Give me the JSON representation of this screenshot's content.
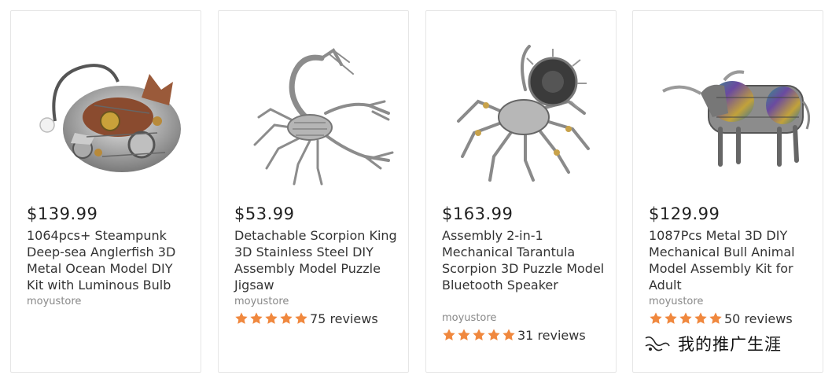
{
  "products": [
    {
      "price": "$139.99",
      "title": "1064pcs+ Steampunk Deep-sea Anglerfish 3D Metal Ocean Model DIY Kit with Luminous Bulb",
      "store": "moyustore",
      "image_subject": "steampunk anglerfish metal model"
    },
    {
      "price": "$53.99",
      "title": "Detachable Scorpion King 3D Stainless Steel DIY Assembly Model Puzzle Jigsaw",
      "store": "moyustore",
      "rating": 5,
      "reviews": "75 reviews",
      "image_subject": "metal scorpion model"
    },
    {
      "price": "$163.99",
      "title": "Assembly 2-in-1 Mechanical Tarantula Scorpion 3D Puzzle Model Bluetooth Speaker",
      "store": "moyustore",
      "rating": 5,
      "reviews": "31 reviews",
      "image_subject": "mechanical tarantula speaker model"
    },
    {
      "price": "$129.99",
      "title": "1087Pcs Metal 3D DIY Mechanical Bull Animal Model Assembly Kit for Adult",
      "store": "moyustore",
      "rating": 5,
      "reviews": "50 reviews",
      "image_subject": "mechanical bull metal model"
    }
  ],
  "watermark": {
    "text": "我的推广生涯",
    "icon": "wechat-channel-icon"
  },
  "colors": {
    "star": "#f0883e",
    "border": "#e6e6e6",
    "text": "#333333",
    "store": "#888888"
  }
}
